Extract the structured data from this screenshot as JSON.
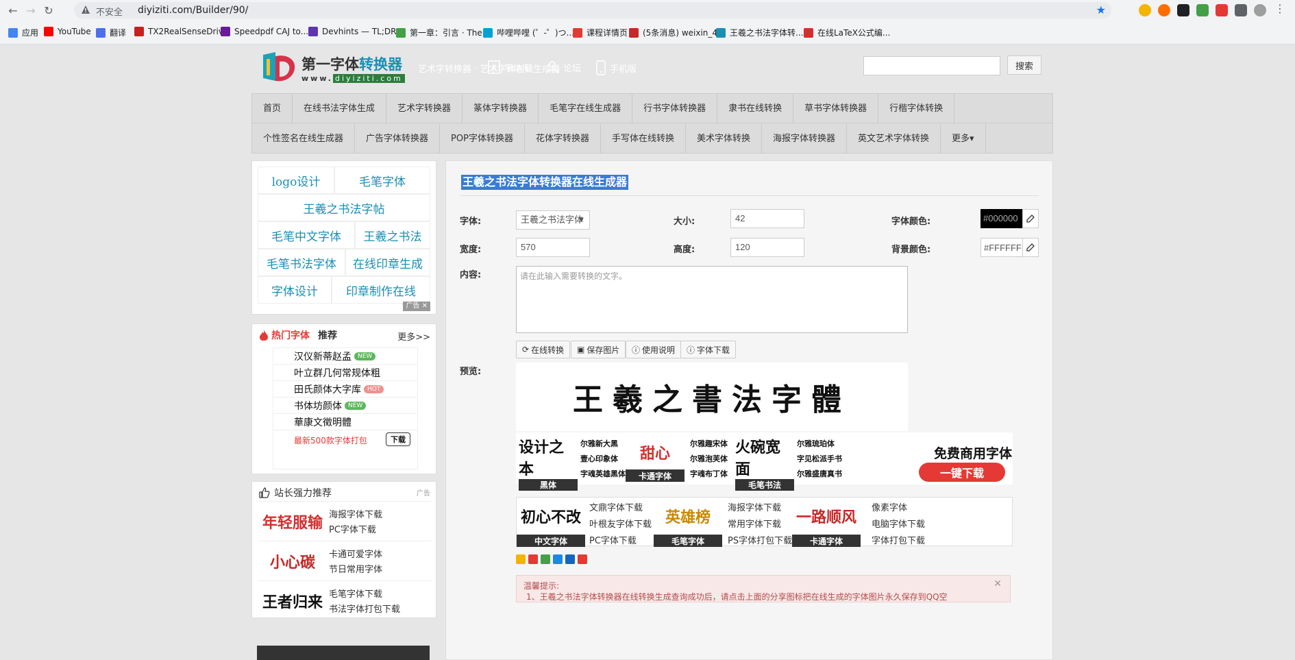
{
  "browser": {
    "security_label": "不安全",
    "url": "diyiziti.com/Builder/90/",
    "bookmarks": [
      {
        "label": "应用",
        "color": "#4285f4"
      },
      {
        "label": "YouTube",
        "color": "#ff0000"
      },
      {
        "label": "翻译",
        "color": "#4e6ef2"
      },
      {
        "label": "TX2RealSenseDriv...",
        "color": "#c5221f"
      },
      {
        "label": "Speedpdf CAJ to...",
        "color": "#6a1b9a"
      },
      {
        "label": "Devhints — TL;DR...",
        "color": "#5e35b1"
      },
      {
        "label": "第一章：引言 · The...",
        "color": "#43a047"
      },
      {
        "label": "哔哩哔哩 (゜-゜)つ...",
        "color": "#00a1d6"
      },
      {
        "label": "课程详情页",
        "color": "#e53935"
      },
      {
        "label": "(5条消息) weixin_4...",
        "color": "#c62828"
      },
      {
        "label": "王羲之书法字体转...",
        "color": "#1a8fb4"
      },
      {
        "label": "在线LaTeX公式编...",
        "color": "#d32f2f"
      }
    ]
  },
  "header": {
    "logo_title_a": "第一字体",
    "logo_title_b": "转换器",
    "logo_domain_prefix": "www.",
    "logo_domain": "diyiziti.com",
    "tagline": "艺术字转换器 · 艺术字体在线生成器",
    "links": [
      "字体库",
      "论坛",
      "手机版"
    ],
    "search_button": "搜索"
  },
  "nav": {
    "row1": [
      "首页",
      "在线书法字体生成",
      "艺术字转换器",
      "篆体字转换器",
      "毛笔字在线生成器",
      "行书字体转换器",
      "隶书在线转换",
      "草书字体转换器",
      "行楷字体转换"
    ],
    "row2": [
      "个性签名在线生成器",
      "广告字体转换器",
      "POP字体转换器",
      "花体字转换器",
      "手写体在线转换",
      "美术字体转换",
      "海报字体转换器",
      "英文艺术字体转换",
      "更多▾"
    ]
  },
  "sidebar": {
    "tags": [
      "logo设计",
      "毛笔字体",
      "王羲之书法字帖",
      "毛笔中文字体",
      "王羲之书法",
      "毛笔书法字体",
      "在线印章生成",
      "字体设计",
      "印章制作在线"
    ],
    "ad_label": "广告",
    "hot": {
      "title": "热门字体",
      "subtitle": "推荐",
      "more": "更多>>",
      "items": [
        {
          "name": "汉仪新蒂赵孟",
          "badge": "NEW",
          "badge_color": "#5cb85c"
        },
        {
          "name": "叶立群几何常规体粗",
          "badge": "",
          "badge_color": ""
        },
        {
          "name": "田氏颜体大字库",
          "badge": "HOT",
          "badge_color": "#f0908f"
        },
        {
          "name": "书体坊颜体",
          "badge": "NEW",
          "badge_color": "#5cb85c"
        },
        {
          "name": "華康文徵明體",
          "badge": "",
          "badge_color": ""
        }
      ],
      "pack_text": "最新500款字体打包",
      "download": "下载"
    },
    "recommend": {
      "title": "站长强力推荐",
      "ad": "广告",
      "rows": [
        {
          "img_text": "年轻服输",
          "img_color": "#d32f2f",
          "line1": "海报字体下载",
          "line2": "PC字体下载"
        },
        {
          "img_text": "小心碳",
          "img_color": "#c62828",
          "line1": "卡通可爱字体",
          "line2": "节日常用字体"
        },
        {
          "img_text": "王者归来",
          "img_color": "#111111",
          "line1": "毛笔字体下载",
          "line2": "书法字体打包下载"
        }
      ]
    }
  },
  "main": {
    "title": "王羲之书法字体转换器在线生成器",
    "font_label": "字体:",
    "font_value": "王羲之书法字体",
    "size_label": "大小:",
    "size_value": "42",
    "color_label": "字体颜色:",
    "color_value": "#000000",
    "width_label": "宽度:",
    "width_value": "570",
    "height_label": "高度:",
    "height_value": "120",
    "bgcolor_label": "背景颜色:",
    "bgcolor_value": "#FFFFFF",
    "content_label": "内容:",
    "content_placeholder": "请在此输入需要转换的文字。",
    "buttons": [
      "在线转换",
      "保存图片",
      "使用说明",
      "字体下载"
    ],
    "preview_label": "预览:",
    "preview_text": "王羲之書法字體"
  },
  "ad_banner1": {
    "cells": [
      {
        "img": "设计之本",
        "cap": "黑体",
        "color": "#111111"
      },
      {
        "img": "甜心",
        "cap": "卡通字体",
        "color": "#d32f2f"
      },
      {
        "img": "火碗宽面",
        "cap": "毛笔书法",
        "color": "#111111"
      }
    ],
    "small_texts": [
      "尔雅新大黑",
      "壹心印象体",
      "字魂英雄黑体",
      "尔雅趣宋体",
      "尔雅泡芙体",
      "字魂布丁体",
      "尔雅琉珀体",
      "字见松派手书",
      "尔雅盛唐真书"
    ],
    "free_title": "免费商用字体",
    "free_button": "一键下载"
  },
  "ad_banner2": {
    "cells": [
      {
        "img": "初心不改",
        "cap": "中文字体",
        "color": "#111111"
      },
      {
        "img": "英雄榜",
        "cap": "毛笔字体",
        "color": "#c98a00"
      },
      {
        "img": "一路顺风",
        "cap": "卡通字体",
        "color": "#c62828"
      }
    ],
    "links": [
      "文鼎字体下载",
      "叶根友字体下载",
      "PC字体下载",
      "海报字体下载",
      "常用字体下载",
      "PS字体打包下载",
      "像素字体",
      "电脑字体下载",
      "字体打包下载"
    ]
  },
  "tip": {
    "title": "温馨提示:",
    "text": "1、王羲之书法字体转换器在线转换生成查询成功后，请点击上面的分享图标把在线生成的字体图片永久保存到QQ空"
  }
}
